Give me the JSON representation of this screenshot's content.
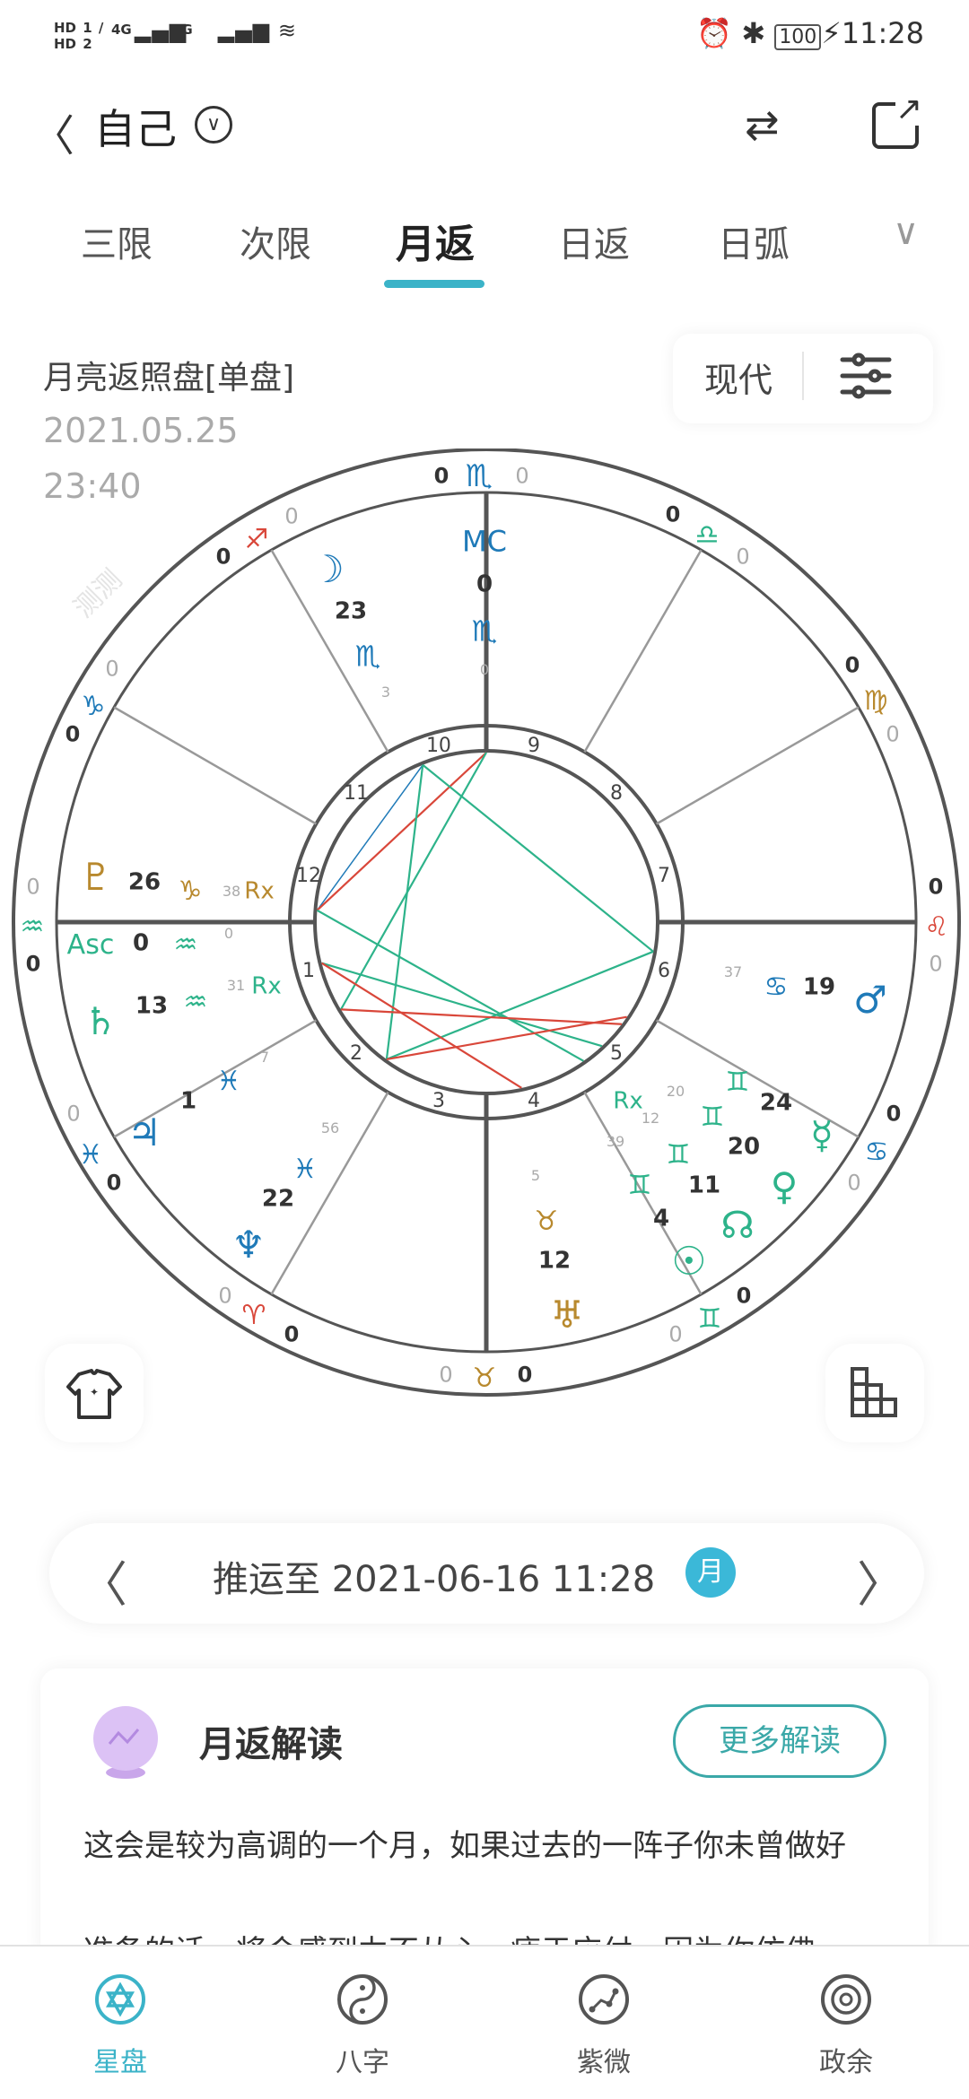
{
  "status_bar": {
    "sim": "HD 1 / HD 2",
    "signal": "4G 4G",
    "time": "11:28",
    "battery": "100"
  },
  "header": {
    "title": "自己",
    "back_icon": "chevron-left-icon",
    "swap_icon": "swap-icon",
    "share_icon": "share-icon"
  },
  "tabs": [
    {
      "label": "三限"
    },
    {
      "label": "次限"
    },
    {
      "label": "月返",
      "active": true
    },
    {
      "label": "日返"
    },
    {
      "label": "日弧"
    }
  ],
  "chart_info": {
    "title": "月亮返照盘[单盘]",
    "date": "2021.05.25",
    "time": "23:40",
    "mode": "现代"
  },
  "colors": {
    "accent": "#3bb3c8",
    "blue": "#1f7ab8",
    "green": "#2db38a",
    "gold": "#b8892e",
    "red": "#d9473a",
    "dark": "#333333",
    "light": "#aaaaaa"
  },
  "wheel": {
    "watermark": "测测",
    "house_numbers": [
      "1",
      "2",
      "3",
      "4",
      "5",
      "6",
      "7",
      "8",
      "9",
      "10",
      "11",
      "12"
    ],
    "labels": [
      [
        "♏",
        "blue"
      ],
      [
        "0",
        "dark"
      ],
      [
        "0",
        "light"
      ],
      [
        "♐",
        "red"
      ],
      [
        "0",
        "dark"
      ],
      [
        "0",
        "light"
      ],
      [
        "♎",
        "green"
      ],
      [
        "0",
        "dark"
      ],
      [
        "0",
        "light"
      ],
      [
        "♑",
        "blue"
      ],
      [
        "0",
        "light"
      ],
      [
        "0",
        "dark"
      ],
      [
        "♍",
        "gold"
      ],
      [
        "0",
        "dark"
      ],
      [
        "0",
        "light"
      ],
      [
        "♒",
        "green"
      ],
      [
        "0",
        "light"
      ],
      [
        "0",
        "dark"
      ],
      [
        "♌",
        "red"
      ],
      [
        "0",
        "dark"
      ],
      [
        "0",
        "light"
      ],
      [
        "♓",
        "blue"
      ],
      [
        "0",
        "light"
      ],
      [
        "0",
        "dark"
      ],
      [
        "♋",
        "blue"
      ],
      [
        "0",
        "dark"
      ],
      [
        "0",
        "light"
      ],
      [
        "♈",
        "red"
      ],
      [
        "0",
        "light"
      ],
      [
        "0",
        "dark"
      ],
      [
        "♊",
        "green"
      ],
      [
        "0",
        "light"
      ],
      [
        "0",
        "dark"
      ],
      [
        "♉",
        "gold"
      ],
      [
        "0",
        "light"
      ],
      [
        "0",
        "dark"
      ],
      [
        "☽",
        "blue"
      ],
      [
        "23",
        "dark"
      ],
      [
        "♏",
        "blue"
      ],
      [
        "3",
        "light"
      ],
      [
        "MC",
        "blue"
      ],
      [
        "0",
        "dark"
      ],
      [
        "♏",
        "blue"
      ],
      [
        "0",
        "light"
      ],
      [
        "♇",
        "gold"
      ],
      [
        "26",
        "dark"
      ],
      [
        "♑",
        "gold"
      ],
      [
        "38",
        "light"
      ],
      [
        "Rx",
        "gold"
      ],
      [
        "Asc",
        "green"
      ],
      [
        "0",
        "dark"
      ],
      [
        "♒",
        "green"
      ],
      [
        "0",
        "light"
      ],
      [
        "31",
        "light"
      ],
      [
        "Rx",
        "green"
      ],
      [
        "♄",
        "green"
      ],
      [
        "13",
        "dark"
      ],
      [
        "♒",
        "green"
      ],
      [
        "7",
        "light"
      ],
      [
        "♓",
        "blue"
      ],
      [
        "1",
        "dark"
      ],
      [
        "♃",
        "blue"
      ],
      [
        "56",
        "light"
      ],
      [
        "♓",
        "blue"
      ],
      [
        "22",
        "dark"
      ],
      [
        "♆",
        "blue"
      ],
      [
        "37",
        "light"
      ],
      [
        "♋",
        "blue"
      ],
      [
        "19",
        "dark"
      ],
      [
        "♂",
        "blue"
      ],
      [
        "20",
        "light"
      ],
      [
        "♊",
        "green"
      ],
      [
        "24",
        "dark"
      ],
      [
        "☿",
        "green"
      ],
      [
        "Rx",
        "green"
      ],
      [
        "12",
        "light"
      ],
      [
        "♊",
        "green"
      ],
      [
        "20",
        "dark"
      ],
      [
        "39",
        "light"
      ],
      [
        "♊",
        "green"
      ],
      [
        "11",
        "dark"
      ],
      [
        "♀",
        "green"
      ],
      [
        "♊",
        "green"
      ],
      [
        "4",
        "dark"
      ],
      [
        "☊",
        "green"
      ],
      [
        "☉",
        "green"
      ],
      [
        "5",
        "light"
      ],
      [
        "♉",
        "gold"
      ],
      [
        "12",
        "dark"
      ],
      [
        "♅",
        "gold"
      ]
    ],
    "aspects": [
      {
        "color": "blue"
      },
      {
        "color": "red"
      },
      {
        "color": "green"
      },
      {
        "color": "green"
      },
      {
        "color": "green"
      },
      {
        "color": "green"
      },
      {
        "color": "green"
      },
      {
        "color": "green"
      },
      {
        "color": "red"
      },
      {
        "color": "red"
      },
      {
        "color": "red"
      }
    ]
  },
  "side_buttons": {
    "left_icon": "tshirt-icon",
    "right_icon": "stairs-grid-icon"
  },
  "transit": {
    "label": "推运至 2021-06-16 11:28",
    "badge": "月"
  },
  "reading": {
    "title": "月返解读",
    "more": "更多解读",
    "lines": [
      "这会是较为高调的一个月，如果过去的一阵子你未曾做好",
      "准备的话，将会感到力不从心、疲于应付。因为你仿佛一"
    ]
  },
  "bottom_nav": [
    {
      "label": "星盘",
      "icon": "star-chart-icon",
      "active": true
    },
    {
      "label": "八字",
      "icon": "yin-yang-icon"
    },
    {
      "label": "紫微",
      "icon": "constellation-icon"
    },
    {
      "label": "政余",
      "icon": "dial-icon"
    }
  ]
}
